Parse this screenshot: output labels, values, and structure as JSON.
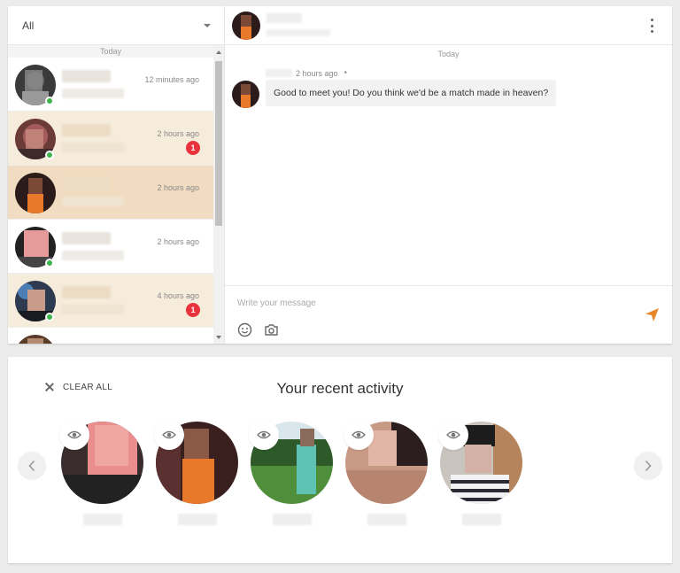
{
  "conversation_list": {
    "filter_label": "All",
    "day_label": "Today",
    "items": [
      {
        "time": "12 minutes ago",
        "badge": "",
        "state": "read",
        "online": true
      },
      {
        "time": "2 hours ago",
        "badge": "1",
        "state": "unread",
        "online": true
      },
      {
        "time": "2 hours ago",
        "badge": "",
        "state": "active",
        "online": false
      },
      {
        "time": "2 hours ago",
        "badge": "",
        "state": "read",
        "online": true
      },
      {
        "time": "4 hours ago",
        "badge": "1",
        "state": "unread",
        "online": true
      }
    ]
  },
  "chat": {
    "day_label": "Today",
    "message_time": "2 hours ago",
    "message_text": "Good to meet you! Do you think we'd be a match made in heaven?",
    "composer_placeholder": "Write your message"
  },
  "activity": {
    "clear_all_label": "CLEAR ALL",
    "title": "Your recent activity",
    "profiles_count": 5
  },
  "colors": {
    "online": "#3cb64b",
    "badge": "#e8323c",
    "send_accent": "#e8862a",
    "unread_row": "#f6ecdc",
    "active_row": "#f2dcc1"
  },
  "icons": [
    "chevron-down-icon",
    "kebab-menu-icon",
    "emoji-icon",
    "camera-icon",
    "send-icon",
    "close-icon",
    "eye-icon",
    "chevron-left-icon",
    "chevron-right-icon"
  ]
}
